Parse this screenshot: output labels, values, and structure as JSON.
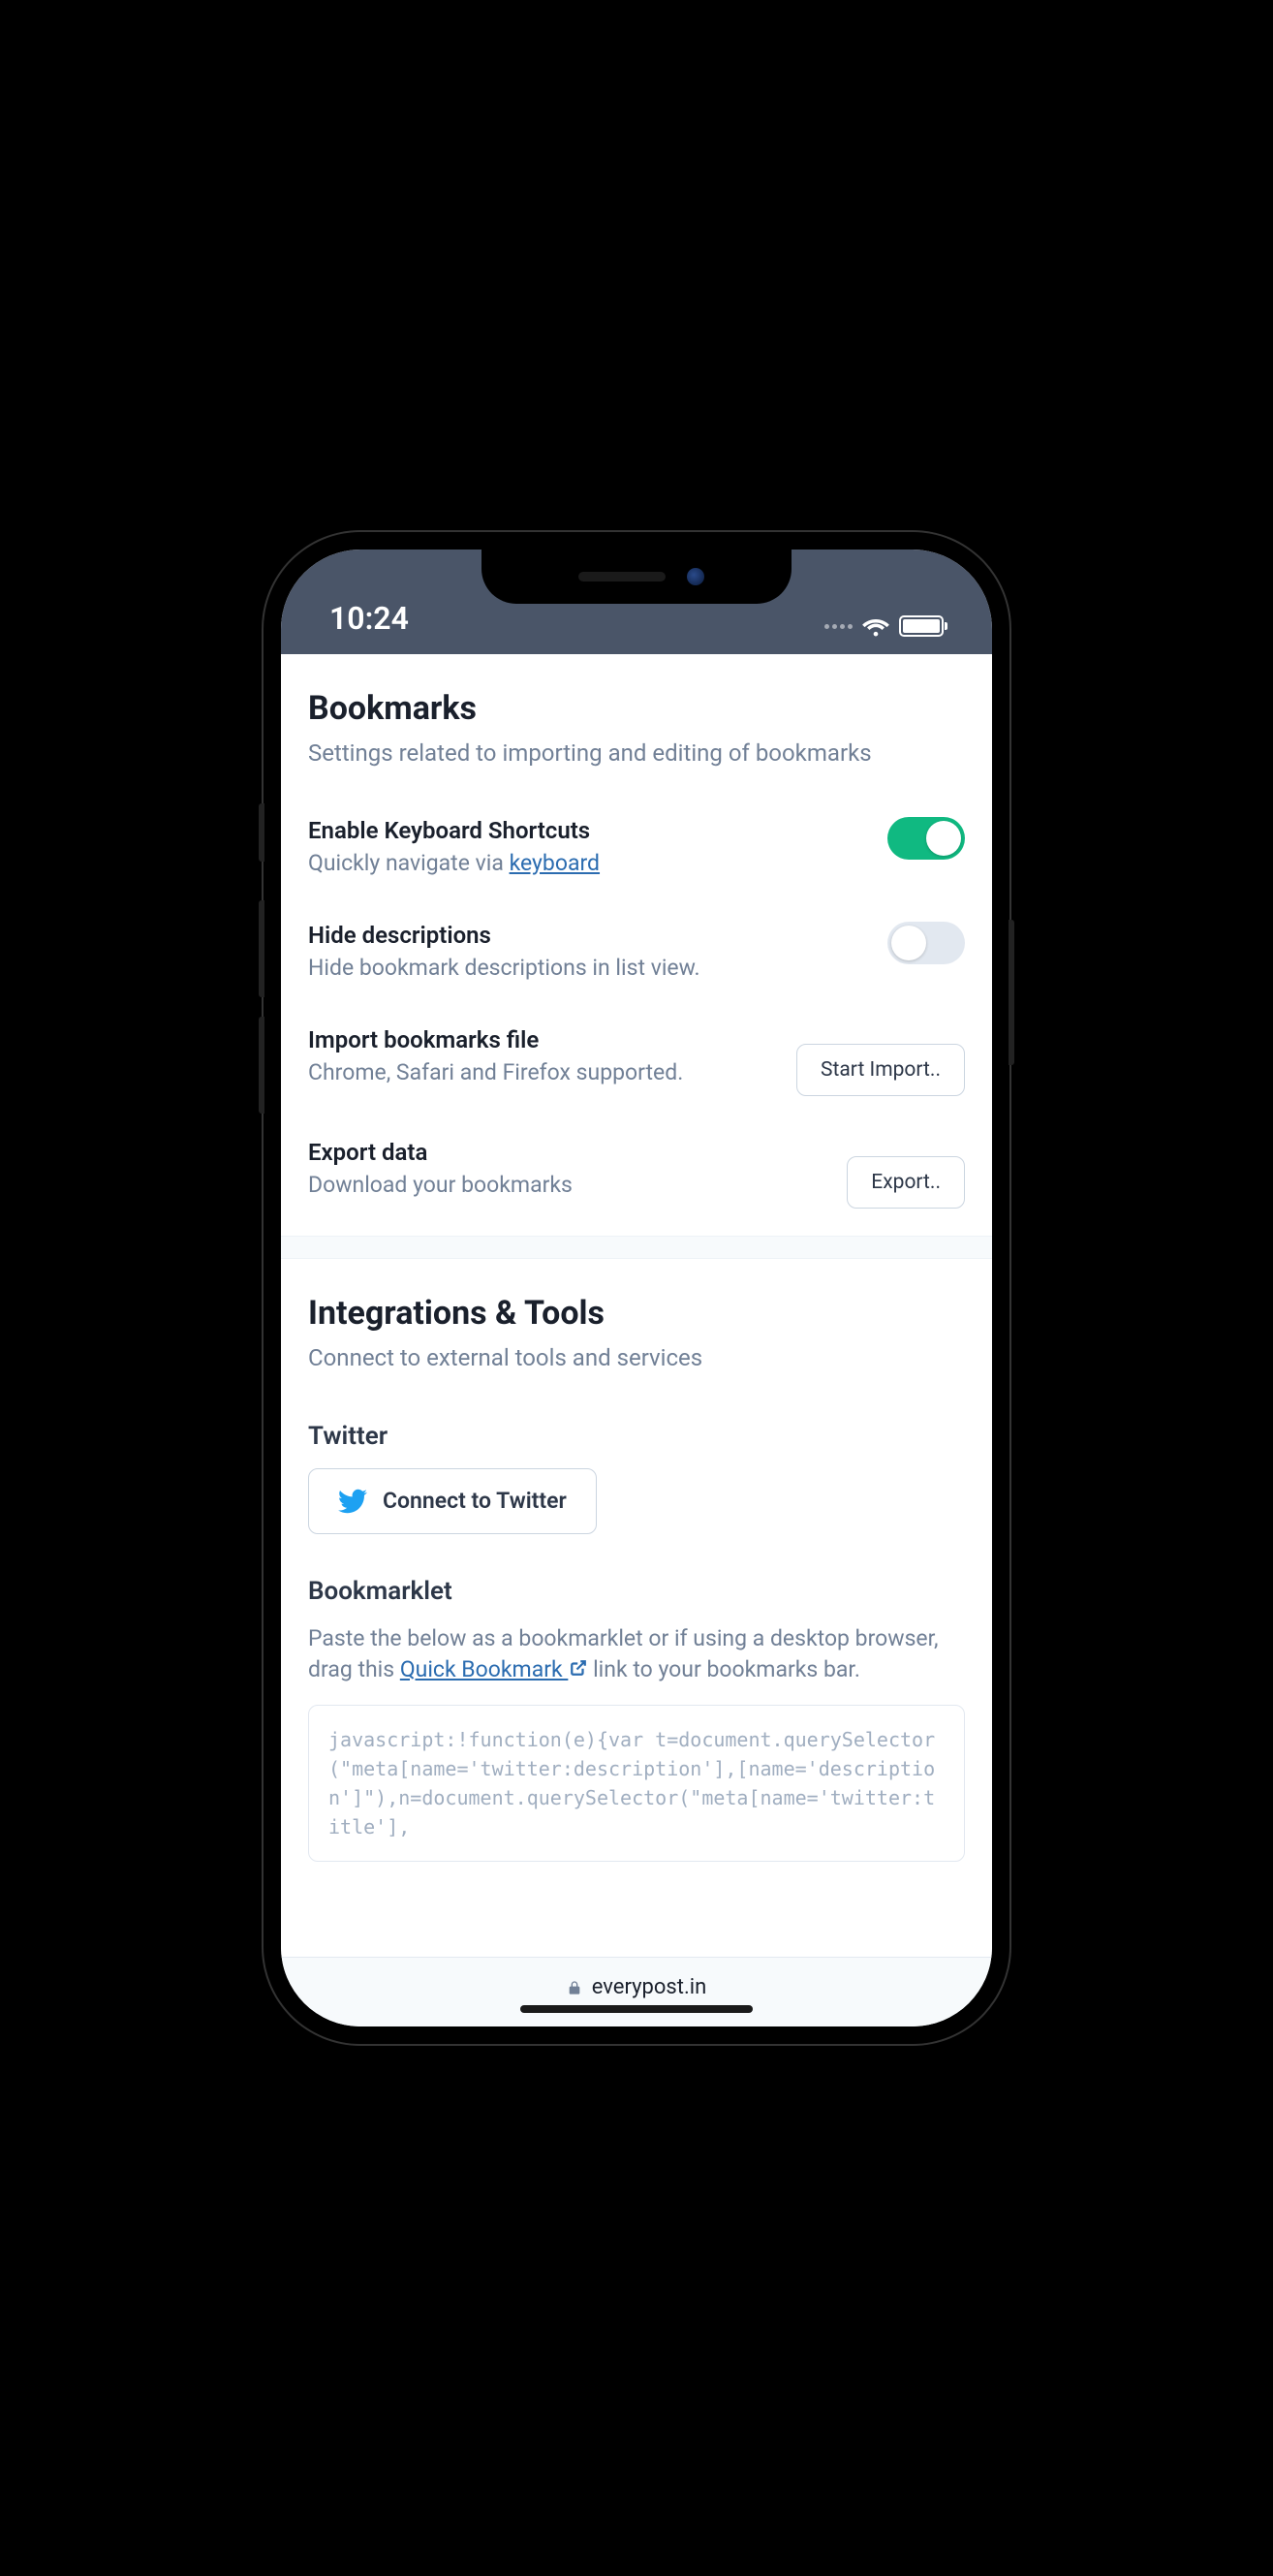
{
  "statusBar": {
    "time": "10:24"
  },
  "bookmarks": {
    "title": "Bookmarks",
    "subtitle": "Settings related to importing and editing of bookmarks",
    "settings": {
      "keyboardShortcuts": {
        "label": "Enable Keyboard Shortcuts",
        "descriptionPrefix": "Quickly navigate via ",
        "linkText": "keyboard",
        "enabled": true
      },
      "hideDescriptions": {
        "label": "Hide descriptions",
        "description": "Hide bookmark descriptions in list view.",
        "enabled": false
      },
      "importBookmarks": {
        "label": "Import bookmarks file",
        "description": "Chrome, Safari and Firefox supported.",
        "buttonLabel": "Start Import.."
      },
      "exportData": {
        "label": "Export data",
        "description": "Download your bookmarks",
        "buttonLabel": "Export.."
      }
    }
  },
  "integrations": {
    "title": "Integrations & Tools",
    "subtitle": "Connect to external tools and services",
    "twitter": {
      "title": "Twitter",
      "buttonLabel": "Connect to Twitter"
    },
    "bookmarklet": {
      "title": "Bookmarklet",
      "descriptionPart1": "Paste the below as a bookmarklet or if using a desktop browser, drag this ",
      "linkText": "Quick Bookmark ",
      "descriptionPart2": "link to your bookmarks bar.",
      "code": "javascript:!function(e){var t=document.querySelector(\"meta[name='twitter:description'],[name='description']\"),n=document.querySelector(\"meta[name='twitter:title'],"
    }
  },
  "browserBar": {
    "url": "everypost.in"
  }
}
